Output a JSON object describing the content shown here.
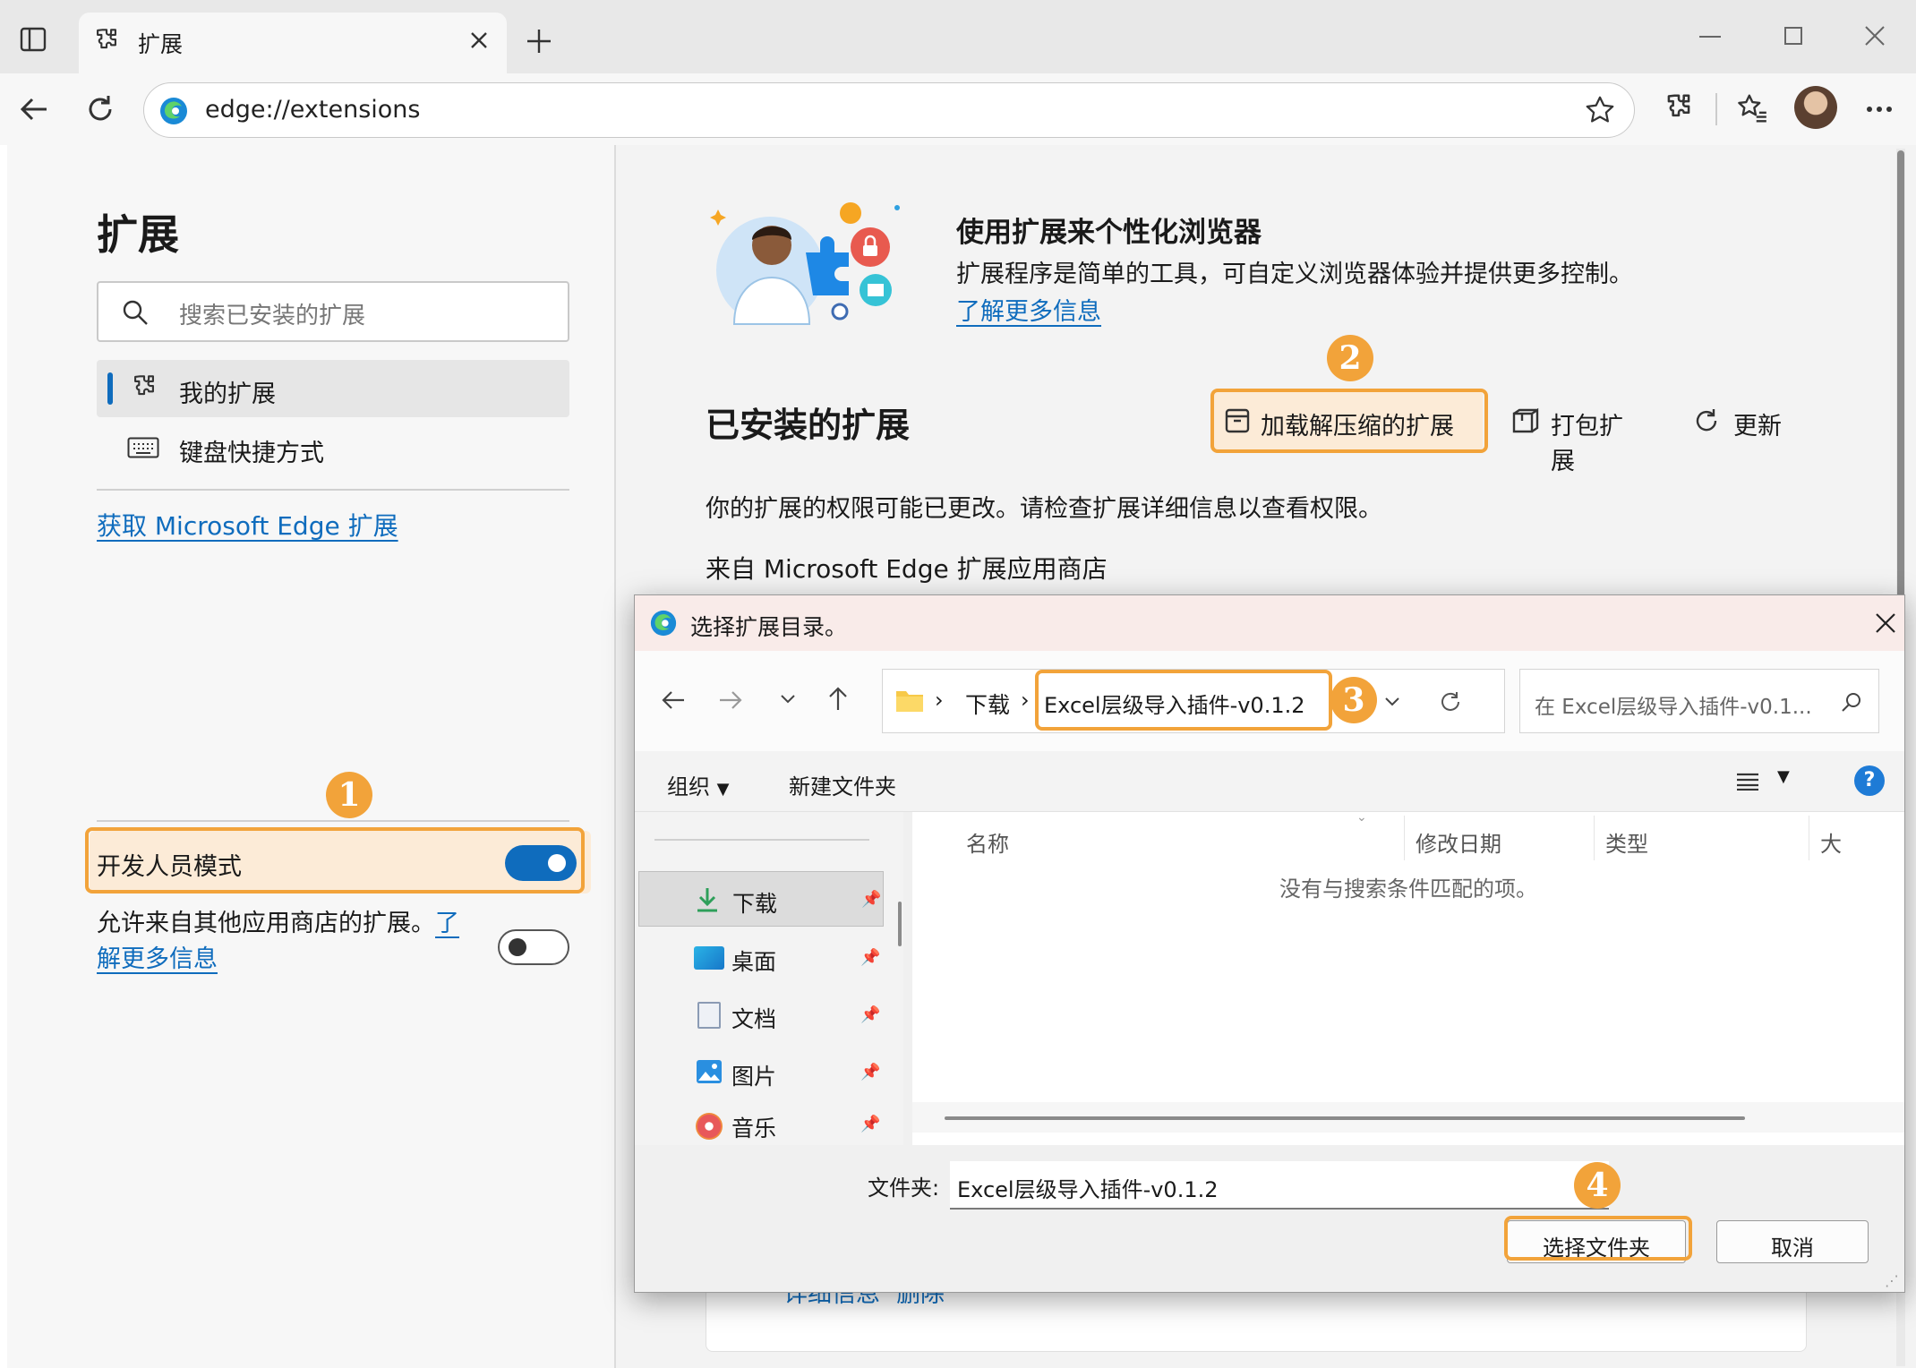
{
  "browser": {
    "tab_title": "扩展",
    "url": "edge://extensions"
  },
  "sidebar": {
    "title": "扩展",
    "search_placeholder": "搜索已安装的扩展",
    "nav": [
      {
        "label": "我的扩展"
      },
      {
        "label": "键盘快捷方式"
      }
    ],
    "get_extensions_link": "获取 Microsoft Edge 扩展",
    "dev_mode_label": "开发人员模式",
    "dev_mode_on": true,
    "allow_other_stores_text": "允许来自其他应用商店的扩展。",
    "allow_other_stores_link_a": "了",
    "allow_other_stores_link_b": "解更多信息",
    "allow_other_stores_on": false
  },
  "main": {
    "promo_title": "使用扩展来个性化浏览器",
    "promo_desc": "扩展程序是简单的工具，可自定义浏览器体验并提供更多控制。",
    "promo_link": "了解更多信息",
    "installed_title": "已安装的扩展",
    "load_unpacked": "加载解压缩的扩展",
    "pack": "打包扩展",
    "update": "更新",
    "permission_notice": "你的扩展的权限可能已更改。请检查扩展详细信息以查看权限。",
    "from_store": "来自 Microsoft Edge 扩展应用商店",
    "details_link": "详细信息",
    "remove_link": "删除"
  },
  "dialog": {
    "title": "选择扩展目录。",
    "breadcrumb_root": "下载",
    "breadcrumb_current": "Excel层级导入插件-v0.1.2",
    "search_placeholder": "在 Excel层级导入插件-v0.1...",
    "organize": "组织",
    "new_folder": "新建文件夹",
    "columns": [
      "名称",
      "修改日期",
      "类型",
      "大"
    ],
    "empty_message": "没有与搜索条件匹配的项。",
    "quick_access": [
      {
        "label": "下载",
        "icon": "download-icon"
      },
      {
        "label": "桌面",
        "icon": "desktop-icon"
      },
      {
        "label": "文档",
        "icon": "document-icon"
      },
      {
        "label": "图片",
        "icon": "picture-icon"
      },
      {
        "label": "音乐",
        "icon": "music-icon"
      }
    ],
    "folder_label": "文件夹:",
    "folder_value": "Excel层级导入插件-v0.1.2",
    "select_button": "选择文件夹",
    "cancel_button": "取消"
  },
  "annotations": {
    "step1": "1",
    "step2": "2",
    "step3": "3",
    "step4": "4"
  },
  "colors": {
    "accent": "#0f6cbd",
    "highlight": "#f2a33a",
    "toggle_on": "#0f6cbd"
  }
}
